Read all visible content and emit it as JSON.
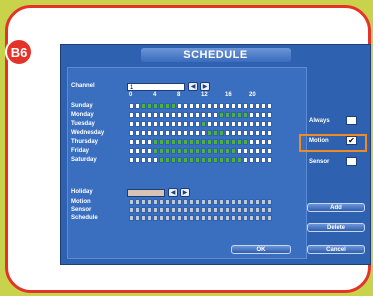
{
  "badge": "B6",
  "window": {
    "title": "SCHEDULE"
  },
  "channel": {
    "label": "Channel",
    "value": "1"
  },
  "hours": [
    "0",
    "4",
    "8",
    "12",
    "16",
    "20"
  ],
  "days": [
    "Sunday",
    "Monday",
    "Tuesday",
    "Wednesday",
    "Thursday",
    "Friday",
    "Saturday"
  ],
  "schedule": [
    [
      0,
      0,
      1,
      1,
      1,
      1,
      1,
      1,
      0,
      0,
      0,
      0,
      0,
      0,
      0,
      0,
      0,
      0,
      0,
      0,
      0,
      0,
      0,
      0
    ],
    [
      0,
      0,
      0,
      0,
      0,
      0,
      0,
      0,
      0,
      0,
      0,
      0,
      0,
      0,
      0,
      1,
      1,
      1,
      1,
      1,
      0,
      0,
      0,
      0
    ],
    [
      0,
      0,
      0,
      0,
      0,
      0,
      0,
      0,
      0,
      0,
      0,
      0,
      1,
      0,
      0,
      0,
      0,
      0,
      0,
      0,
      0,
      0,
      0,
      0
    ],
    [
      0,
      0,
      0,
      0,
      0,
      0,
      0,
      0,
      0,
      0,
      0,
      0,
      0,
      1,
      1,
      1,
      0,
      0,
      0,
      0,
      0,
      0,
      0,
      0
    ],
    [
      0,
      0,
      0,
      0,
      1,
      1,
      1,
      1,
      1,
      1,
      1,
      1,
      1,
      1,
      1,
      1,
      1,
      1,
      1,
      1,
      0,
      0,
      0,
      0
    ],
    [
      0,
      0,
      0,
      0,
      1,
      1,
      1,
      1,
      1,
      1,
      1,
      1,
      1,
      1,
      1,
      1,
      1,
      1,
      0,
      0,
      0,
      0,
      0,
      0
    ],
    [
      0,
      0,
      0,
      0,
      0,
      1,
      1,
      1,
      1,
      1,
      1,
      1,
      1,
      1,
      1,
      1,
      1,
      1,
      1,
      0,
      0,
      0,
      0,
      0
    ]
  ],
  "options": {
    "always": {
      "label": "Always",
      "checked": false
    },
    "motion": {
      "label": "Motion",
      "checked": true,
      "mark": "✔"
    },
    "sensor": {
      "label": "Sensor",
      "checked": false
    }
  },
  "holiday": {
    "label": "Holiday",
    "rows": [
      "Motion",
      "Sensor",
      "Schedule"
    ]
  },
  "buttons": {
    "add": "Add",
    "delete": "Delete",
    "ok": "OK",
    "cancel": "Cancel"
  },
  "colors": {
    "accent": "#e4342a",
    "highlight": "#f08a24",
    "scheduled": "#4bb33a"
  }
}
